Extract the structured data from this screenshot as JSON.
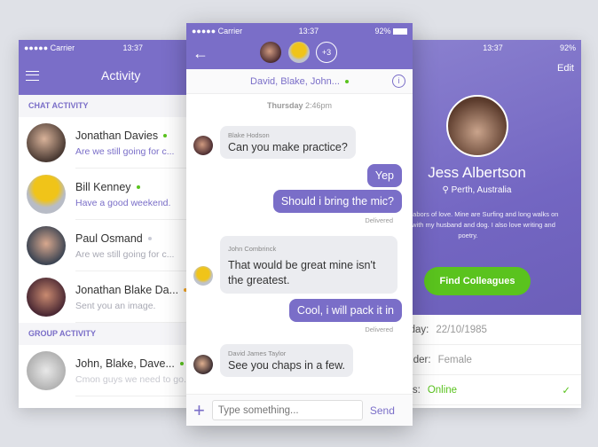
{
  "status": {
    "carrier": "●●●●● Carrier",
    "time": "13:37",
    "battery": "92%"
  },
  "left": {
    "title": "Activity",
    "chat_section": "CHAT ACTIVITY",
    "group_section": "GROUP ACTIVITY",
    "chats": [
      {
        "name": "Jonathan Davies",
        "message": "Are we still going for c...",
        "status": "#5ac31e",
        "msg_color": "#7a6ec8"
      },
      {
        "name": "Bill Kenney",
        "message": "Have a good weekend.",
        "status": "#5ac31e",
        "msg_color": "#7a6ec8"
      },
      {
        "name": "Paul Osmand",
        "message": "Are we still going for c...",
        "status": "#c9cbd6",
        "msg_color": "#a8a9b4"
      },
      {
        "name": "Jonathan Blake Da...",
        "message": "Sent you an image.",
        "status": "#f5a623",
        "msg_color": "#a8a9b4"
      }
    ],
    "groups": [
      {
        "name": "John, Blake, Dave...",
        "message": "Cmon guys we need to go...",
        "status": "#5ac31e",
        "msg_color": "#c8c9d0"
      }
    ]
  },
  "mid": {
    "more_count": "+3",
    "participants": "David, Blake, John...",
    "day": "Thursday",
    "time": "2:46pm",
    "messages": [
      {
        "sender": "Blake Hodson",
        "text": "Can you make practice?"
      },
      {
        "text": "Yep"
      },
      {
        "text": "Should i bring the mic?",
        "note": "Delivered"
      },
      {
        "sender": "John Combrinck",
        "text": "That would be great mine isn't the greatest."
      },
      {
        "text": "Cool, i will pack it in",
        "note": "Delivered"
      },
      {
        "sender": "David James Taylor",
        "text": "See you chaps in a few."
      }
    ],
    "input_placeholder": "Type something...",
    "send": "Send"
  },
  "right": {
    "edit": "Edit",
    "name": "Jess Albertson",
    "location": "Perth, Australia",
    "bio": "I believe in labors of love. Mine are Surfing and long walks on the beach with my husband and dog. I also love writing and poetry.",
    "cta": "Find Colleagues",
    "birthday_label": "Birthday:",
    "birthday": "22/10/1985",
    "gender_label": "Gender:",
    "gender": "Female",
    "status_label": "Status:",
    "status": "Online"
  },
  "colors": {
    "accent": "#7a6ec8",
    "green": "#5ac31e"
  }
}
